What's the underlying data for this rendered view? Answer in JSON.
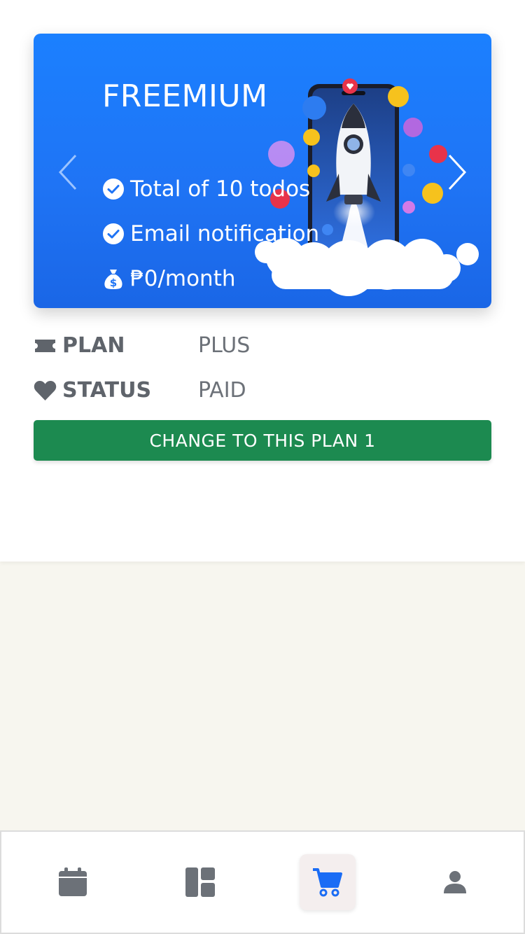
{
  "plan_card": {
    "title": "FREEMIUM",
    "features": [
      {
        "icon": "check-circle-icon",
        "text": "Total of 10 todos"
      },
      {
        "icon": "check-circle-icon",
        "text": "Email notification"
      },
      {
        "icon": "money-bag-icon",
        "text": "₱0/month"
      }
    ],
    "prev_icon": "chevron-left-icon",
    "next_icon": "chevron-right-icon",
    "background_color": "#1f74f5"
  },
  "details": {
    "plan": {
      "icon": "ticket-icon",
      "label": "PLAN",
      "value": "PLUS"
    },
    "status": {
      "icon": "heart-icon",
      "label": "STATUS",
      "value": "PAID"
    }
  },
  "change_button": {
    "label": "CHANGE TO THIS PLAN 1",
    "color": "#1c8a50"
  },
  "bottom_nav": {
    "items": [
      {
        "name": "calendar",
        "icon": "calendar-icon",
        "active": false
      },
      {
        "name": "dashboard",
        "icon": "dashboard-icon",
        "active": false
      },
      {
        "name": "cart",
        "icon": "cart-icon",
        "active": true
      },
      {
        "name": "profile",
        "icon": "user-icon",
        "active": false
      }
    ],
    "active_color": "#1a6cf5",
    "inactive_color": "#6c7178"
  }
}
